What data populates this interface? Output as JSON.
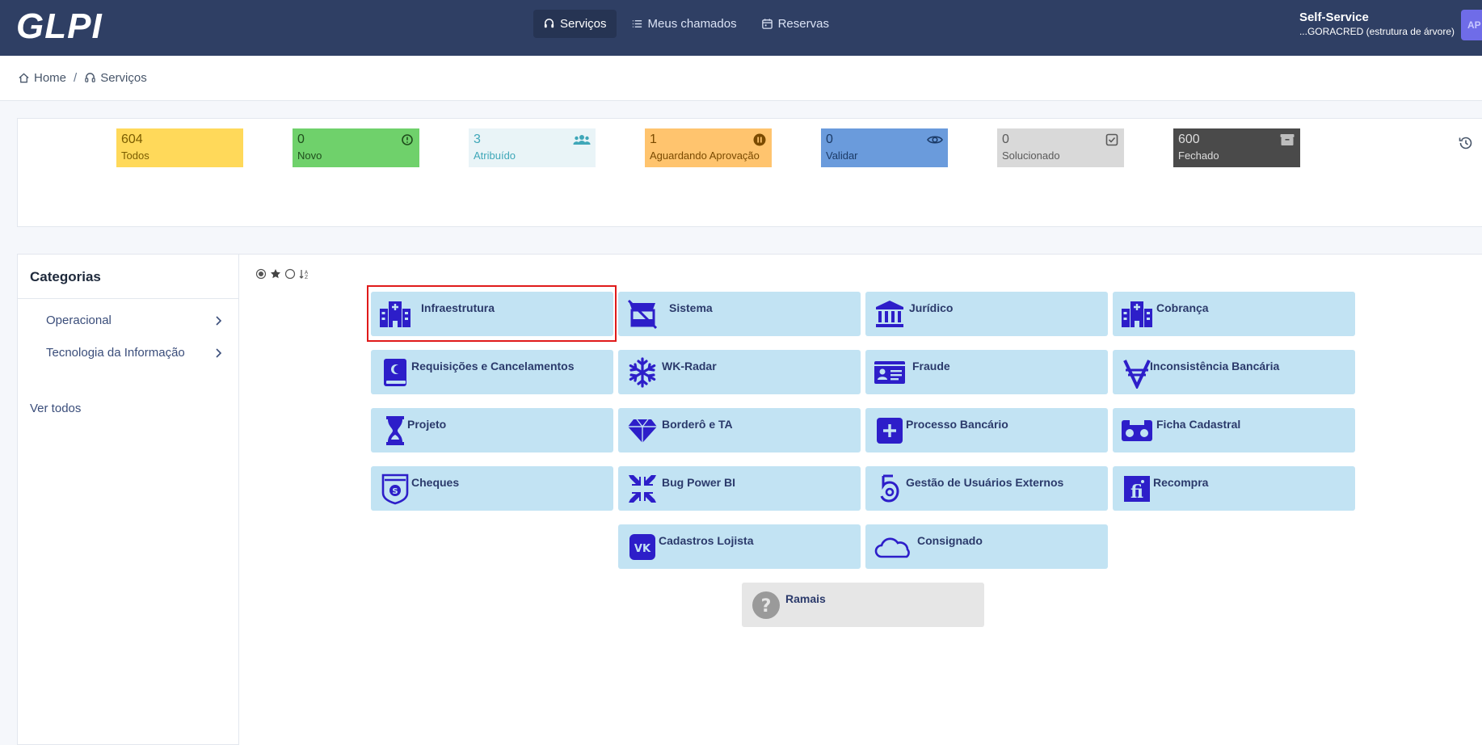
{
  "header": {
    "logo": "GLPI",
    "nav": [
      {
        "label": "Serviços",
        "icon": "headset-icon",
        "active": true
      },
      {
        "label": "Meus chamados",
        "icon": "list-icon",
        "active": false
      },
      {
        "label": "Reservas",
        "icon": "calendar-icon",
        "active": false
      }
    ],
    "profile_title": "Self-Service",
    "profile_entity": "...GORACRED (estrutura de árvore)",
    "avatar_initials": "AP"
  },
  "breadcrumb": {
    "home": "Home",
    "separator": "/",
    "current": "Serviços"
  },
  "stats": [
    {
      "value": "604",
      "label": "Todos",
      "bg": "#ffd95a",
      "fg": "#7a5c00",
      "icon": ""
    },
    {
      "value": "0",
      "label": "Novo",
      "bg": "#6fd16b",
      "fg": "#1f4d1c",
      "icon": "alert-circle-icon"
    },
    {
      "value": "3",
      "label": "Atribuído",
      "bg": "#e9f4f7",
      "fg": "#3fa7b8",
      "icon": "users-icon"
    },
    {
      "value": "1",
      "label": "Aguardando Aprovação",
      "bg": "#ffc46e",
      "fg": "#7a4a00",
      "icon": "pause-circle-icon"
    },
    {
      "value": "0",
      "label": "Validar",
      "bg": "#6a9bdc",
      "fg": "#1b3a66",
      "icon": "eye-icon"
    },
    {
      "value": "0",
      "label": "Solucionado",
      "bg": "#d9d9d9",
      "fg": "#5a5a5a",
      "icon": "check-square-icon"
    },
    {
      "value": "600",
      "label": "Fechado",
      "bg": "#4a4a4a",
      "fg": "#dddddd",
      "icon": "archive-icon"
    }
  ],
  "sidebar": {
    "title": "Categorias",
    "items": [
      {
        "label": "Operacional"
      },
      {
        "label": "Tecnologia da Informação"
      }
    ],
    "see_all": "Ver todos"
  },
  "tiles": [
    {
      "label": "Infraestrutura",
      "icon": "hospital-icon"
    },
    {
      "label": "Sistema",
      "icon": "store-slash-icon"
    },
    {
      "label": "Jurídico",
      "icon": "landmark-icon"
    },
    {
      "label": "Cobrança",
      "icon": "hospital-icon"
    },
    {
      "label": "Requisições e Cancelamentos",
      "icon": "quran-book-icon"
    },
    {
      "label": "WK-Radar",
      "icon": "snowflake-icon"
    },
    {
      "label": "Fraude",
      "icon": "id-card-icon"
    },
    {
      "label": "Inconsistência Bancária",
      "icon": "viacoin-icon"
    },
    {
      "label": "Projeto",
      "icon": "hourglass-icon"
    },
    {
      "label": "Borderô e TA",
      "icon": "gem-icon"
    },
    {
      "label": "Processo Bancário",
      "icon": "plus-square-icon"
    },
    {
      "label": "Ficha Cadastral",
      "icon": "cassette-icon"
    },
    {
      "label": "Cheques",
      "icon": "coin-shield-icon"
    },
    {
      "label": "Bug Power BI",
      "icon": "compress-arrows-icon"
    },
    {
      "label": "Gestão de Usuários Externos",
      "icon": "five-hundred-px-icon"
    },
    {
      "label": "Recompra",
      "icon": "fi-logo-icon"
    },
    {
      "label": "Cadastros Lojista",
      "icon": "vk-icon"
    },
    {
      "label": "Consignado",
      "icon": "cloud-icon"
    },
    {
      "label": "Ramais",
      "icon": "question-circle-icon"
    }
  ],
  "colors": {
    "topbar": "#2f3f64",
    "tile_bg": "#c2e3f3",
    "icon_color": "#2d1ec9",
    "highlight": "#e01a1a"
  }
}
